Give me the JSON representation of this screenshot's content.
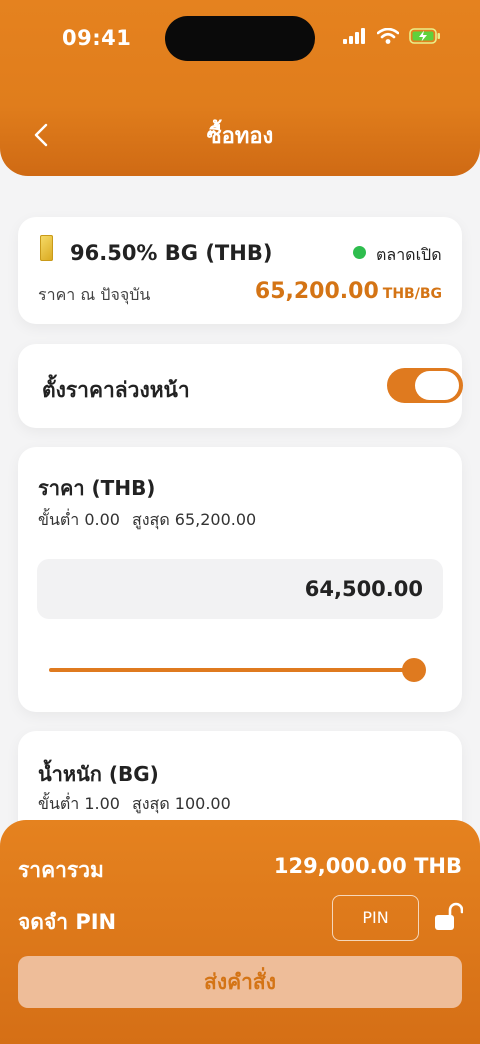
{
  "status_bar": {
    "time": "09:41"
  },
  "header": {
    "title": "ซื้อทอง"
  },
  "product": {
    "name": "96.50% BG (THB)",
    "market_status": "ตลาดเปิด",
    "price_label": "ราคา ณ ปัจจุบัน",
    "price": "65,200.00",
    "price_unit": "THB/BG"
  },
  "preset": {
    "label": "ตั้งราคาล่วงหน้า",
    "enabled": true
  },
  "price_field": {
    "title": "ราคา (THB)",
    "min_label": "ขั้นต่ำ 0.00",
    "max_label": "สูงสุด 65,200.00",
    "value": "64,500.00",
    "slider_fraction": 0.99
  },
  "weight_field": {
    "title": "น้ำหนัก (BG)",
    "min_label": "ขั้นต่ำ 1.00",
    "max_label": "สูงสุด 100.00"
  },
  "summary": {
    "total_label": "ราคารวม",
    "total_value": "129,000.00 THB",
    "pin_label": "จดจำ PIN",
    "pin_button": "PIN",
    "submit": "ส่งคำสั่ง"
  },
  "colors": {
    "accent": "#df7a1f",
    "market_open": "#2ebd4e",
    "submit_bg": "#eebd99"
  },
  "icons": [
    "back-arrow-icon",
    "signal-icon",
    "wifi-icon",
    "battery-charging-icon",
    "gold-bar-icon",
    "unlock-icon"
  ]
}
